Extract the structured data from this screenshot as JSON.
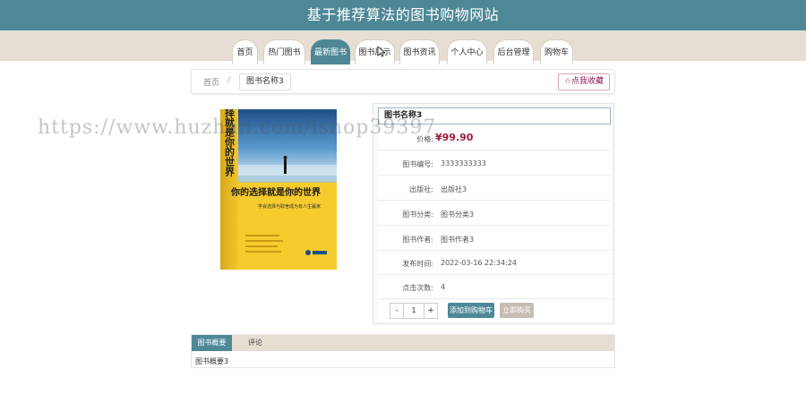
{
  "header": {
    "title": "基于推荐算法的图书购物网站"
  },
  "nav": {
    "items": [
      {
        "label": "首页"
      },
      {
        "label": "热门图书"
      },
      {
        "label": "最新图书"
      },
      {
        "label": "图书展示"
      },
      {
        "label": "图书资讯"
      },
      {
        "label": "个人中心"
      },
      {
        "label": "后台管理"
      },
      {
        "label": "购物车"
      }
    ],
    "active_index": 2
  },
  "breadcrumb": {
    "home": "首页",
    "separator": "/",
    "current": "图书名称3"
  },
  "favorite": {
    "icon": "star-outline-icon",
    "label": "☆点我收藏"
  },
  "book": {
    "cover_title": "你的选择就是你的世界",
    "cover_spine": "你的选择就是你的世界",
    "cover_subtitle": "学会选择与取舍成为有人生赢家"
  },
  "details": {
    "name": "图书名称3",
    "price_label": "价格:",
    "price": "¥99.90",
    "rows": [
      {
        "label": "图书编号:",
        "value": "3333333333"
      },
      {
        "label": "出版社:",
        "value": "出版社3"
      },
      {
        "label": "图书分类:",
        "value": "图书分类3"
      },
      {
        "label": "图书作者:",
        "value": "图书作者3"
      },
      {
        "label": "发布时间:",
        "value": "2022-03-16 22:34:24"
      },
      {
        "label": "点击次数:",
        "value": "4"
      }
    ]
  },
  "purchase": {
    "minus": "-",
    "quantity": "1",
    "plus": "+",
    "add_to_cart": "添加到购物车",
    "buy_now": "立即购买"
  },
  "tabs": {
    "items": [
      {
        "label": "图书概要"
      },
      {
        "label": "评论"
      }
    ],
    "content": "图书概要3"
  },
  "watermark": {
    "text": "https://www.huzhan.com/ishop39397"
  },
  "colors": {
    "primary": "#4e8896",
    "nav_bg": "#e6ddd3",
    "price": "#a01c3c",
    "favorite": "#8b2050"
  }
}
